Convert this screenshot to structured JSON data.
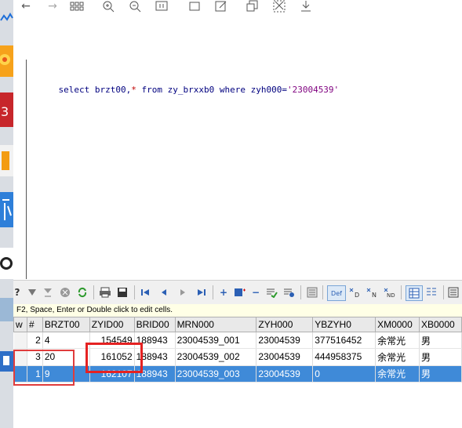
{
  "toolbar": {
    "icons": [
      "back-arrow-icon",
      "forward-arrow-icon",
      "grid-icon",
      "zoom-in-icon",
      "zoom-out-icon",
      "fit-icon",
      "rectangle-icon",
      "edit-icon",
      "copy-icon",
      "cut-icon",
      "download-icon"
    ]
  },
  "editor": {
    "sql": {
      "select": "select",
      "cols": " brzt00,",
      "star": "*",
      "from": " from",
      "table": " zy_brxxb0",
      "where": " where",
      "cond": " zyh000=",
      "literal": "'23004539'"
    }
  },
  "grid_toolbar": {
    "question": "?",
    "def_label": "Def"
  },
  "hint": "F2, Space, Enter or Double click to edit cells.",
  "grid": {
    "columns": [
      "w",
      "#",
      "BRZT00",
      "ZYID00",
      "BRID00",
      "MRN000",
      "ZYH000",
      "YBZYH0",
      "XM0000",
      "XB0000"
    ],
    "rows": [
      {
        "rownum": "2",
        "status": "4",
        "zyid": "154549",
        "brid": "188943",
        "mrn": "23004539_001",
        "zyh": "23004539",
        "ybzyh": "377516452",
        "name": "余常光",
        "sex": "男"
      },
      {
        "rownum": "3",
        "status": "20",
        "zyid": "161052",
        "brid": "188943",
        "mrn": "23004539_002",
        "zyh": "23004539",
        "ybzyh": "444958375",
        "name": "余常光",
        "sex": "男"
      },
      {
        "rownum": "1",
        "status": "9",
        "zyid": "162107",
        "brid": "188943",
        "mrn": "23004539_003",
        "zyh": "23004539",
        "ybzyh": "0",
        "name": "余常光",
        "sex": "男"
      }
    ]
  },
  "colors": {
    "selection": "#3f8ad8",
    "annotation": "#e52222"
  }
}
